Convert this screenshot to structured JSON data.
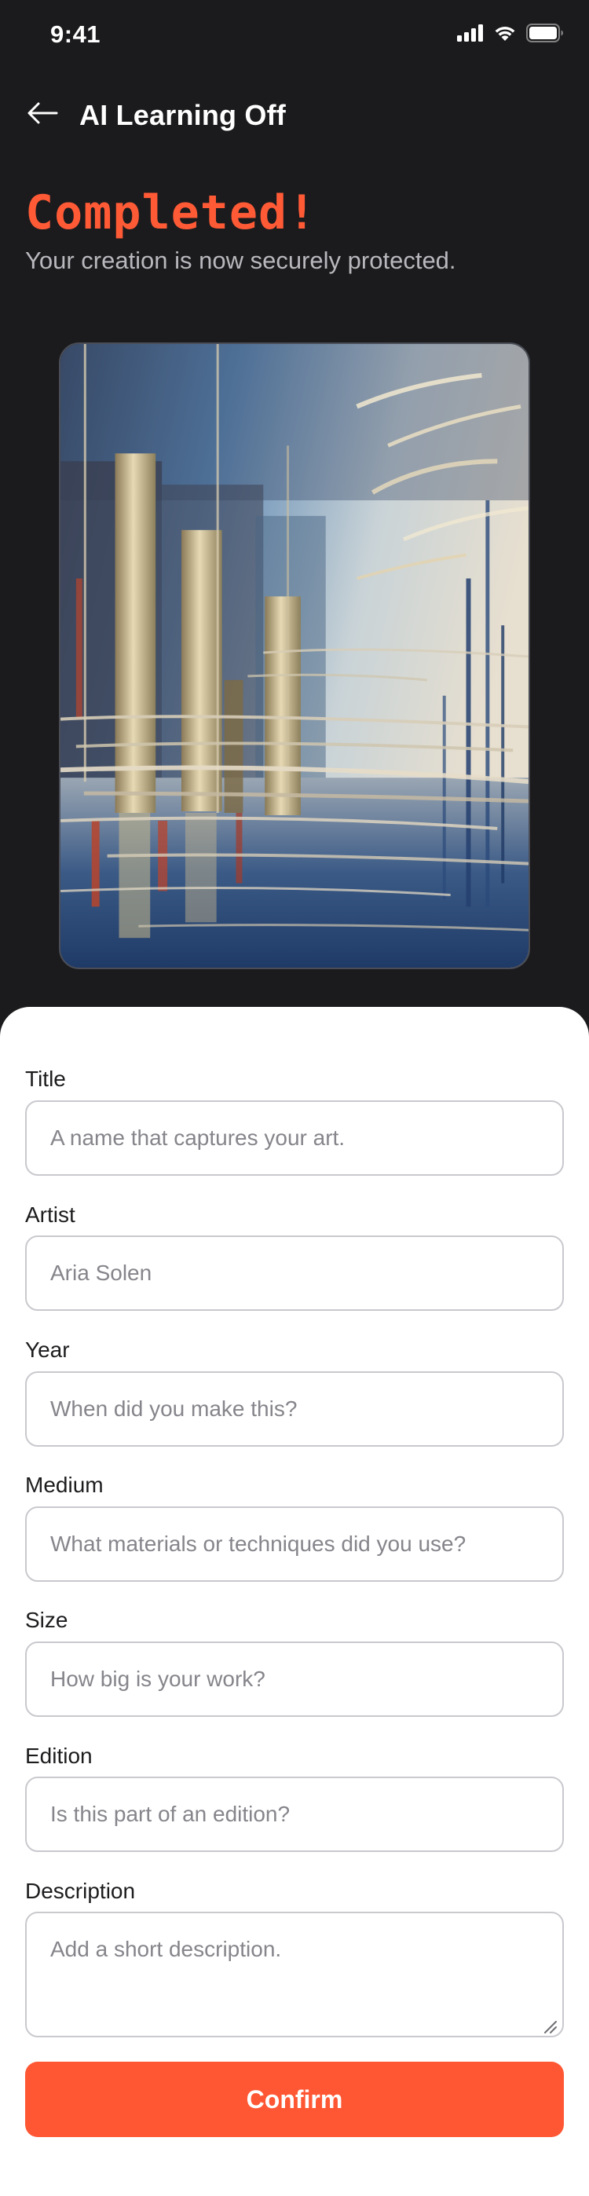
{
  "status_bar": {
    "time": "9:41"
  },
  "nav": {
    "title": "AI Learning Off",
    "back_icon": "arrow-left-icon"
  },
  "header": {
    "title": "Completed!",
    "subtitle": "Your creation is now securely protected.",
    "title_color": "#ff5a36"
  },
  "artwork": {
    "description_icon": "artwork-image"
  },
  "form": {
    "title": {
      "label": "Title",
      "value": "",
      "placeholder": "A name that captures your art."
    },
    "artist": {
      "label": "Artist",
      "value": "",
      "placeholder": "Aria Solen"
    },
    "year": {
      "label": "Year",
      "value": "",
      "placeholder": "When did you make this?"
    },
    "medium": {
      "label": "Medium",
      "value": "",
      "placeholder": "What materials or techniques did you use?"
    },
    "size": {
      "label": "Size",
      "value": "",
      "placeholder": "How big is your work?"
    },
    "edition": {
      "label": "Edition",
      "value": "",
      "placeholder": "Is this part of an edition?"
    },
    "description": {
      "label": "Description",
      "value": "",
      "placeholder": "Add a short description."
    }
  },
  "confirm_label": "Confirm",
  "colors": {
    "accent": "#ff5733",
    "background": "#1b1b1d",
    "sheet": "#ffffff"
  }
}
